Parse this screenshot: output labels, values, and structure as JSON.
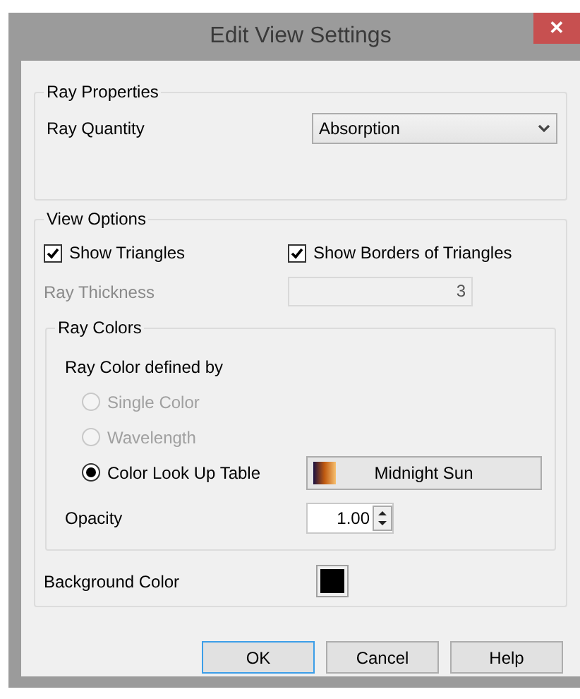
{
  "window": {
    "title": "Edit View Settings",
    "close": "✕"
  },
  "ray_properties": {
    "legend": "Ray Properties",
    "ray_quantity": {
      "label": "Ray Quantity",
      "value": "Absorption"
    }
  },
  "view_options": {
    "legend": "View Options",
    "checkboxes": [
      {
        "label": "Show Triangles",
        "checked": true
      },
      {
        "label": "Show Borders of Triangles",
        "checked": true
      }
    ],
    "ray_thickness": {
      "label": "Ray Thickness",
      "value": "3",
      "disabled": true
    },
    "ray_colors": {
      "legend": "Ray Colors",
      "defined_by": "Ray Color defined by",
      "radios": [
        {
          "label": "Single Color",
          "selected": false,
          "disabled": true
        },
        {
          "label": "Wavelength",
          "selected": false,
          "disabled": true
        },
        {
          "label": "Color Look Up Table",
          "selected": true,
          "disabled": false
        }
      ],
      "color_table": {
        "label": "Midnight Sun"
      },
      "opacity": {
        "label": "Opacity",
        "value": "1.00"
      }
    },
    "background_color": {
      "label": "Background Color",
      "color": "#000000"
    }
  },
  "buttons": [
    {
      "label": "OK",
      "default": true
    },
    {
      "label": "Cancel",
      "default": false
    },
    {
      "label": "Help",
      "default": false
    }
  ]
}
